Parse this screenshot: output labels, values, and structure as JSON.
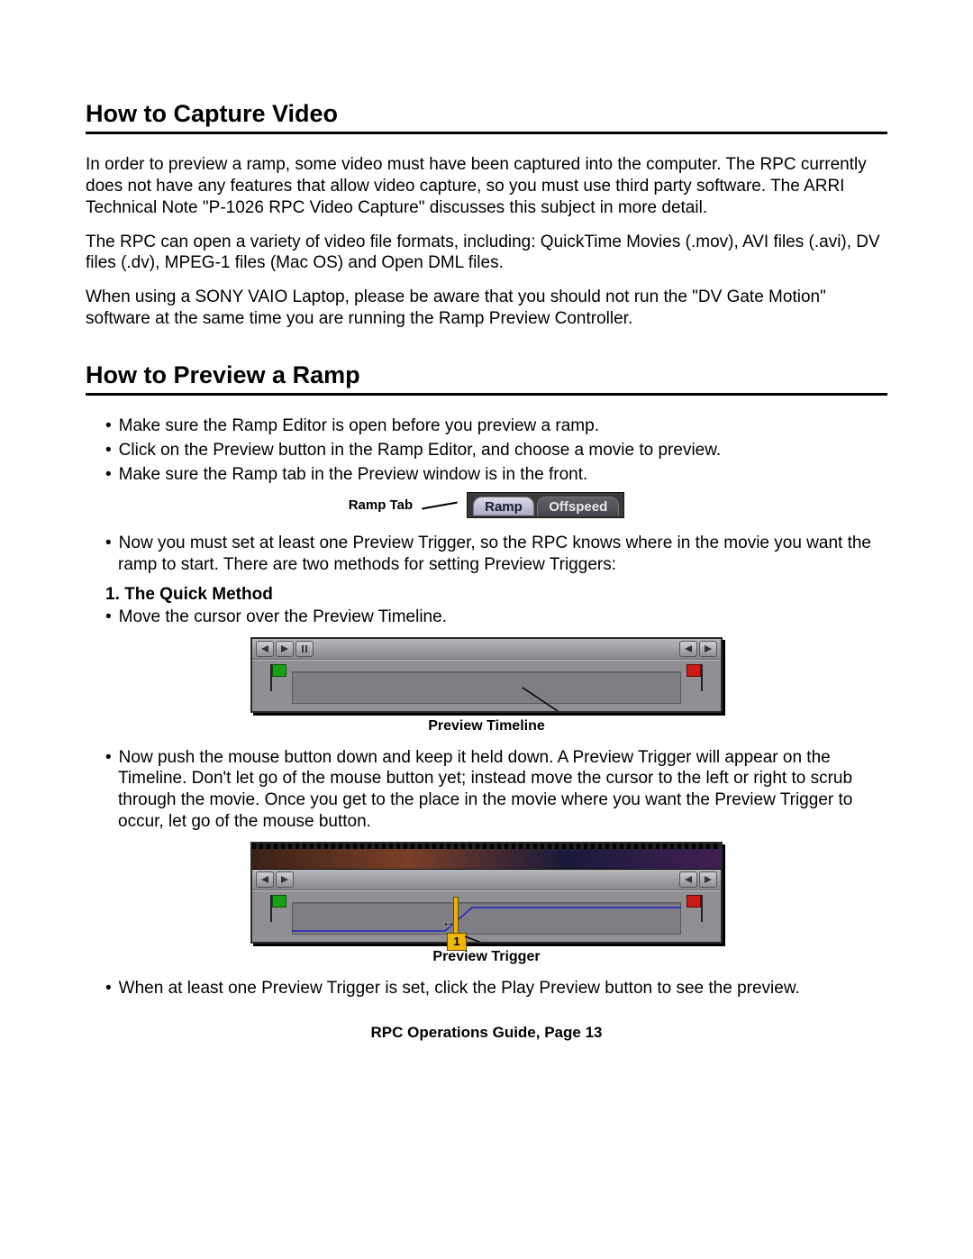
{
  "section1": {
    "heading": "How to Capture Video",
    "para1": "In order to preview a ramp, some video must have been captured into the computer. The RPC currently does not have any features that allow video capture, so you must use third party software. The ARRI Technical Note \"P-1026 RPC Video Capture\" discusses this subject in more detail.",
    "para2": "The RPC can open a variety of video file formats, including: QuickTime Movies (.mov), AVI files (.avi), DV files (.dv), MPEG-1 files (Mac OS) and Open DML files.",
    "para3": "When using a SONY VAIO Laptop, please be aware that you should not run the \"DV Gate Motion\" software at the same time you are running the Ramp Preview Controller."
  },
  "section2": {
    "heading": "How to Preview a Ramp",
    "bullets1": [
      "Make sure the Ramp Editor is open before you preview a ramp.",
      "Click on the Preview button in the Ramp Editor, and choose a movie to preview.",
      "Make sure the Ramp tab in the Preview window is in the front."
    ],
    "ramptab_label": "Ramp Tab",
    "tab_active": "Ramp",
    "tab_inactive": "Offspeed",
    "bullets2": [
      "Now you must set at least one Preview Trigger, so the RPC knows where in the movie you want the ramp to start. There are two methods for setting Preview Triggers:"
    ],
    "quick_method_heading": "1. The Quick Method",
    "bullets3": [
      "Move the cursor over the Preview Timeline."
    ],
    "caption1": "Preview Timeline",
    "bullets4": [
      "Now push the mouse button down and keep it held down. A Preview Trigger will appear on the Timeline. Don't let go of the mouse button yet; instead move the cursor to the left or right to scrub through the movie. Once you get to the place in the movie where you want the Preview Trigger to occur, let go of the mouse button."
    ],
    "trigger_number": "1",
    "caption2": "Preview Trigger",
    "bullets5": [
      "When at least one Preview Trigger is set, click the Play Preview button to see the preview."
    ]
  },
  "footer": "RPC Operations Guide, Page 13"
}
